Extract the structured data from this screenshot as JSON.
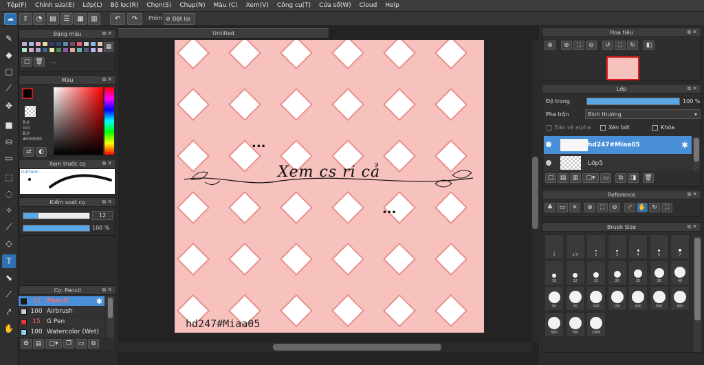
{
  "menu": [
    "Tệp(F)",
    "Chỉnh sửa(E)",
    "Lớp(L)",
    "Bộ lọc(R)",
    "Chọn(S)",
    "Chụp(N)",
    "Màu (C)",
    "Xem(V)",
    "Công cụ(T)",
    "Cửa sổ(W)",
    "Cloud",
    "Help"
  ],
  "toolbar": {
    "phim_label": "Phím",
    "reset_label": "Đặt lại"
  },
  "palette": {
    "title": "Bảng màu",
    "swatches": [
      "#c9a6d8",
      "#a6b8e8",
      "#e8a6b8",
      "#e8d6a6",
      "#3a3a6a",
      "#2a4a7a",
      "#5a8aaa",
      "#7a4a6a",
      "#e85a7a",
      "#c8c8c8",
      "#8ab8e8",
      "#e8c8a6",
      "#a6e8c8",
      "#d8a6c8",
      "#a6a6d8",
      "#3a6a8a",
      "#e8e8a6",
      "#4a8a5a",
      "#8a5aaa",
      "#e8a6a6",
      "#6ab8a6",
      "#5a5a8a",
      "#b8b8e8",
      "#e8b8d8"
    ],
    "more": "..."
  },
  "color": {
    "title": "Màu",
    "r": "R:0",
    "g": "G:0",
    "b": "B:0",
    "hex": "#000000"
  },
  "brush_preview": {
    "title": "Xem trước cọ",
    "size": "0.87mm"
  },
  "brush_control": {
    "title": "Kiểm soát cọ",
    "size": "12",
    "opacity": "100 %",
    "size_fraction": 0.12,
    "opacity_fraction": 1.0
  },
  "brushes": {
    "title": "Cọ: Pencil",
    "items": [
      {
        "size": "12",
        "name": "Pencil",
        "color": "#1b1b1b",
        "selected": true
      },
      {
        "size": "100",
        "name": "Airbrush",
        "color": "#cfcfcf",
        "selected": false
      },
      {
        "size": "15",
        "name": "G Pen",
        "color": "#e03a3a",
        "selected": false
      },
      {
        "size": "100",
        "name": "Watercolor (Wet)",
        "color": "#8fd3f0",
        "selected": false
      }
    ]
  },
  "canvas": {
    "tab": "Untitled",
    "text_main": "Xem cs ri cả",
    "text_dots1": "...",
    "text_dots2": "...",
    "signature": "hd247#Miaa05",
    "bg": "#f7c1bd",
    "pattern": "#e88f8d"
  },
  "navigator": {
    "title": "Hoa tiêu"
  },
  "layers": {
    "title": "Lớp",
    "opacity_label": "Độ trong",
    "opacity_value": "100 %",
    "opacity_fraction": 1.0,
    "blend_label": "Pha trộn",
    "blend_value": "Bình thường",
    "alpha_label": "Bảo vệ alpha",
    "clip_label": "Xén bớt",
    "lock_label": "Khóa",
    "items": [
      {
        "name": "hd247#Miaa05",
        "selected": true
      },
      {
        "name": "Lớp5",
        "selected": false
      }
    ]
  },
  "reference": {
    "title": "Reference"
  },
  "brush_size": {
    "title": "Brush Size",
    "sizes": [
      "1",
      "1.5",
      "2",
      "3",
      "4",
      "5",
      "7",
      "10",
      "12",
      "15",
      "20",
      "25",
      "30",
      "40",
      "50",
      "70",
      "100",
      "150",
      "200",
      "300",
      "400",
      "500",
      "700",
      "1000"
    ]
  }
}
